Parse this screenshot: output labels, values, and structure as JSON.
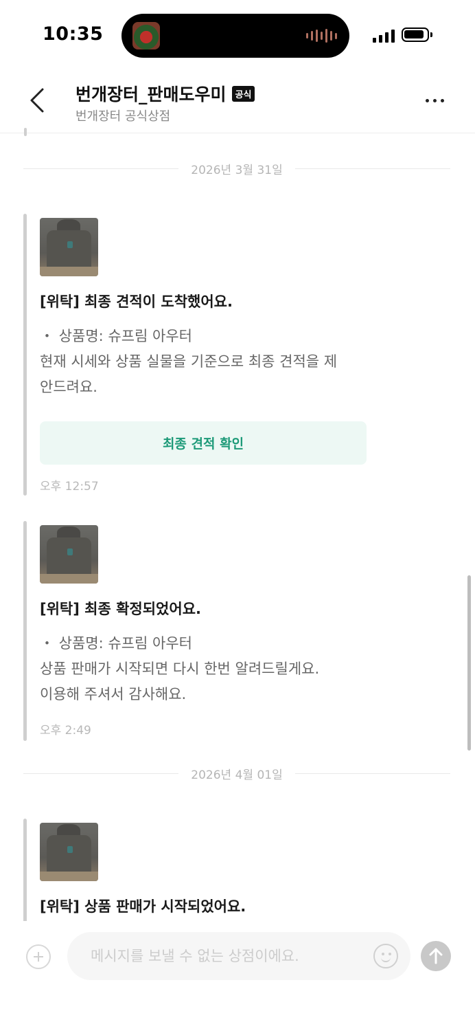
{
  "status_bar": {
    "time": "10:35"
  },
  "header": {
    "title": "번개장터_판매도우미",
    "badge": "공식",
    "subtitle": "번개장터 공식상점"
  },
  "chat": {
    "date_separators": [
      "2026년 3월 31일",
      "2026년 4월 01일"
    ],
    "messages": [
      {
        "headline": "[위탁] 최종 견적이 도착했어요.",
        "body_lines": [
          "・ 상품명: 슈프림 아우터",
          "현재 시세와 상품 실물을 기준으로 최종 견적을 제",
          "안드려요."
        ],
        "button": "최종 견적 확인",
        "time": "오후 12:57"
      },
      {
        "headline": "[위탁] 최종 확정되었어요.",
        "body_lines": [
          "・ 상품명: 슈프림 아우터",
          "상품 판매가 시작되면 다시 한번 알려드릴게요.",
          "이용해 주셔서 감사해요."
        ],
        "time": "오후 2:49"
      },
      {
        "headline": "[위탁] 상품 판매가 시작되었어요."
      }
    ]
  },
  "input_bar": {
    "placeholder": "메시지를 보낼 수 없는 상점이에요."
  },
  "icons": {
    "back": "chevron-left-icon",
    "more": "more-horizontal-icon",
    "plus": "plus-circle-icon",
    "emoji": "smile-icon",
    "send": "arrow-up-icon"
  },
  "colors": {
    "accent": "#1d9a78",
    "button_bg": "#edf8f4"
  }
}
